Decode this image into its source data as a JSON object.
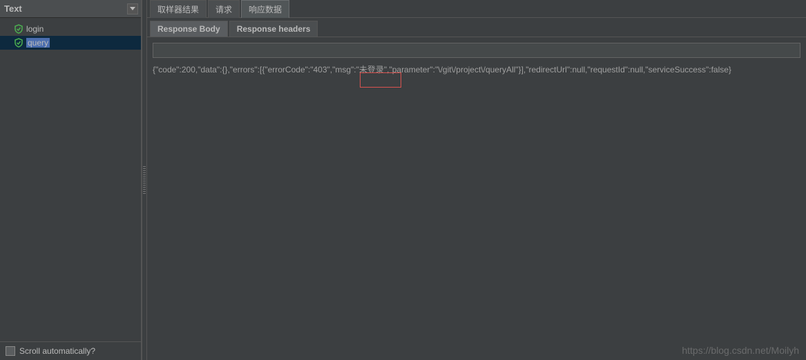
{
  "leftPanel": {
    "header": "Text",
    "items": [
      {
        "label": "login",
        "selected": false
      },
      {
        "label": "query",
        "selected": true
      }
    ],
    "footerLabel": "Scroll automatically?"
  },
  "topTabs": [
    {
      "label": "取样器结果",
      "active": false
    },
    {
      "label": "请求",
      "active": false
    },
    {
      "label": "响应数据",
      "active": true
    }
  ],
  "subTabs": [
    {
      "label": "Response Body",
      "active": true
    },
    {
      "label": "Response headers",
      "active": false
    }
  ],
  "responseBody": "{\"code\":200,\"data\":{},\"errors\":[{\"errorCode\":\"403\",\"msg\":\"未登录\",\"parameter\":\"\\/git\\/project\\/queryAll\"}],\"redirectUrl\":null,\"requestId\":null,\"serviceSuccess\":false}",
  "watermark": "https://blog.csdn.net/Moilyh"
}
